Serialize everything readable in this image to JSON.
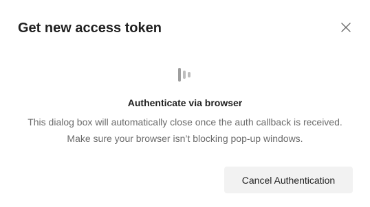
{
  "dialog": {
    "title": "Get new access token",
    "close_icon": "close-icon",
    "loader_icon": "loading-bars-icon",
    "heading": "Authenticate via browser",
    "message": "This dialog box will automatically close once the auth callback is received. Make sure your browser isn’t blocking pop-up windows.",
    "cancel_label": "Cancel Authentication"
  },
  "colors": {
    "title": "#212121",
    "message": "#6b6b6b",
    "button_bg": "#f2f2f2",
    "loader": "#9e9e9e"
  }
}
